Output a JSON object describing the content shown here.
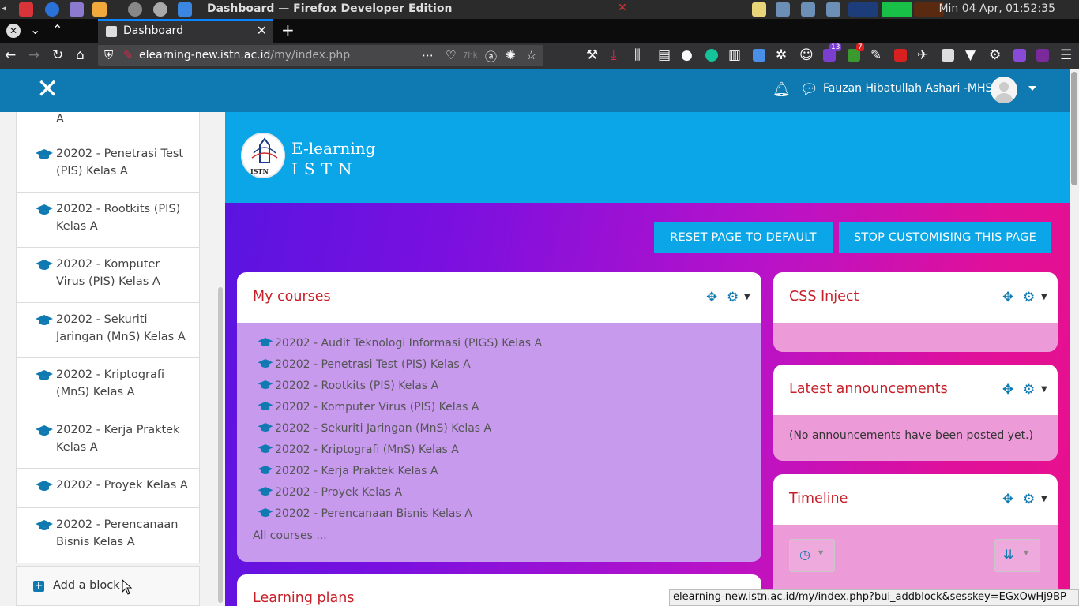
{
  "os": {
    "window_title": "Dashboard — Firefox Developer Edition",
    "clock": "Min 04 Apr, 01:52:35"
  },
  "browser": {
    "tab_title": "Dashboard",
    "url_domain": "elearning-new.istn.ac.id",
    "url_path": "/my/index.php",
    "pocket_count": "7hk",
    "badge_13": "13",
    "badge_7": "7",
    "status_url": "elearning-new.istn.ac.id/my/index.php?bui_addblock&sesskey=EGxOwHj9BP"
  },
  "navbar": {
    "username": "Fauzan Hibatullah Ashari -MHS"
  },
  "drawer": {
    "items": [
      "A",
      "20202 - Penetrasi Test (PIS) Kelas A",
      "20202 - Rootkits (PIS) Kelas A",
      "20202 - Komputer Virus (PIS) Kelas A",
      "20202 - Sekuriti Jaringan (MnS) Kelas A",
      "20202 - Kriptografi (MnS) Kelas A",
      "20202 - Kerja Praktek Kelas A",
      "20202 - Proyek Kelas A",
      "20202 - Perencanaan Bisnis Kelas A"
    ],
    "add_block": "Add a block"
  },
  "banner": {
    "brand_line1": "E-learning",
    "brand_line2": "ISTN",
    "logo_text": "ISTN"
  },
  "buttons": {
    "reset": "RESET PAGE TO DEFAULT",
    "stop": "STOP CUSTOMISING THIS PAGE"
  },
  "my_courses": {
    "title": "My courses",
    "courses": [
      "20202 - Audit Teknologi Informasi (PIGS) Kelas A",
      "20202 - Penetrasi Test (PIS) Kelas A",
      "20202 - Rootkits (PIS) Kelas A",
      "20202 - Komputer Virus (PIS) Kelas A",
      "20202 - Sekuriti Jaringan (MnS) Kelas A",
      "20202 - Kriptografi (MnS) Kelas A",
      "20202 - Kerja Praktek Kelas A",
      "20202 - Proyek Kelas A",
      "20202 - Perencanaan Bisnis Kelas A"
    ],
    "all_courses": "All courses ..."
  },
  "css_inject": {
    "title": "CSS Inject"
  },
  "announcements": {
    "title": "Latest announcements",
    "empty": "(No announcements have been posted yet.)"
  },
  "timeline": {
    "title": "Timeline"
  },
  "learning_plans": {
    "title": "Learning plans"
  },
  "colors": {
    "navbar": "#0f7ab1",
    "banner": "#0aa6e8",
    "card_title": "#c8202a"
  }
}
